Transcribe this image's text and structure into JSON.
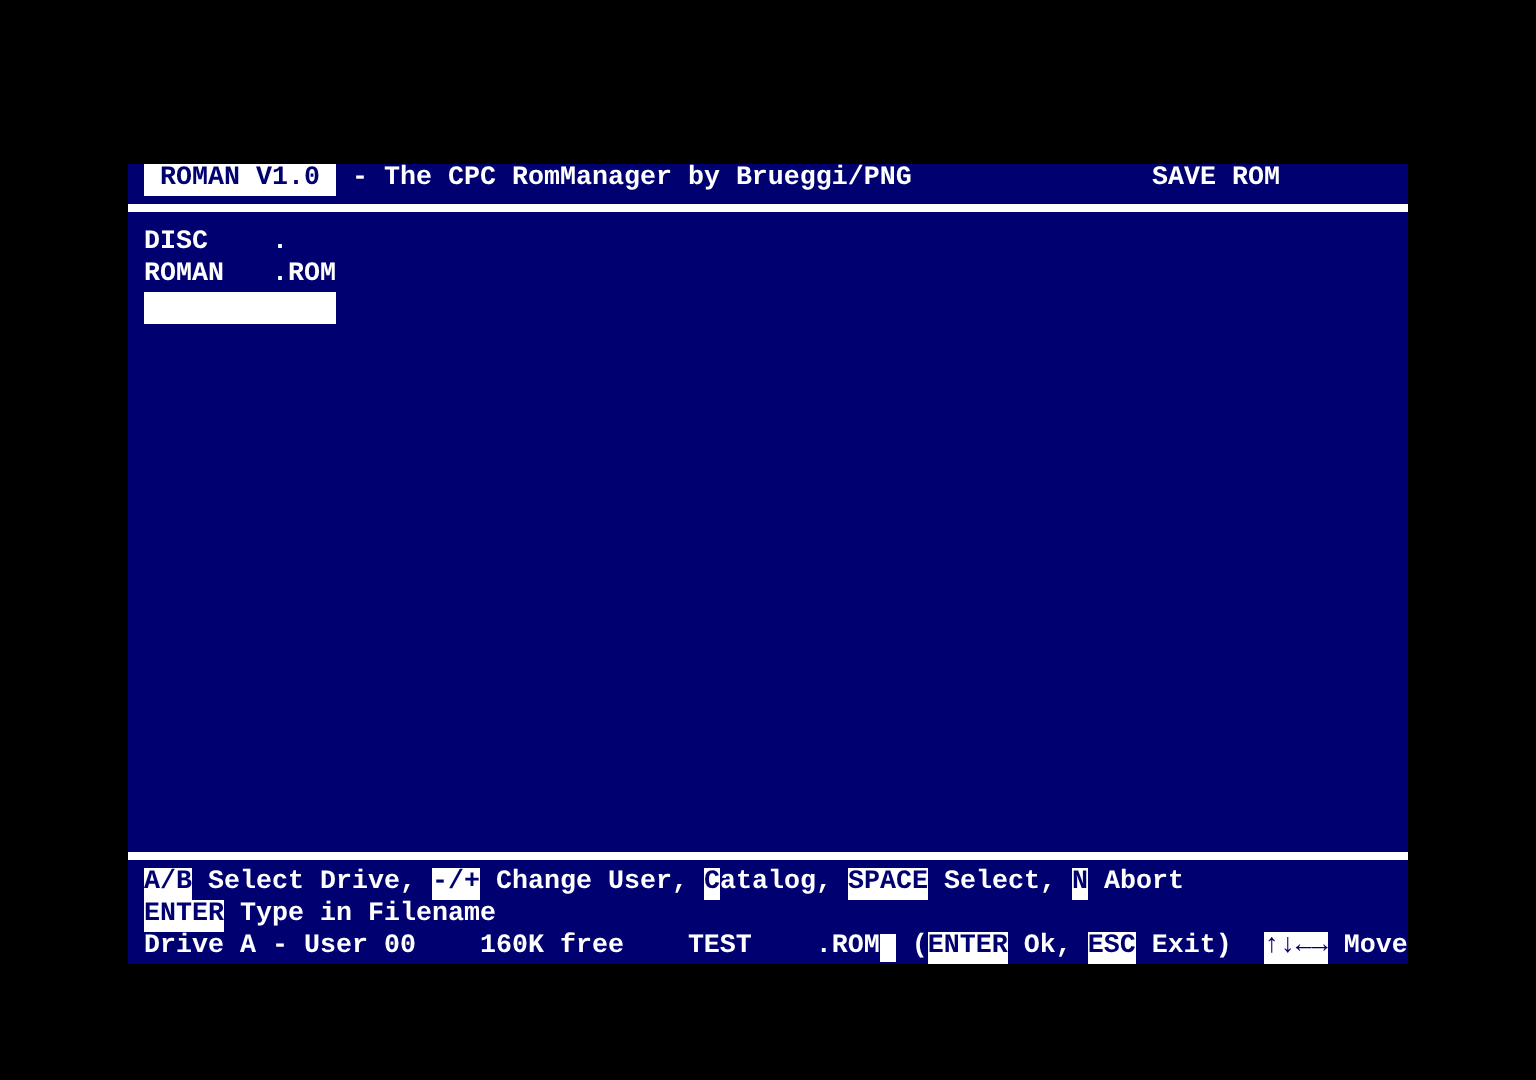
{
  "header": {
    "program": "ROMAN V1.0",
    "subtitle": " - The CPC RomManager by Brueggi/PNG",
    "mode": "SAVE ROM"
  },
  "files": [
    {
      "name": "DISC",
      "ext": "."
    },
    {
      "name": "ROMAN",
      "ext": ".ROM"
    }
  ],
  "help_lines": [
    [
      {
        "kind": "key",
        "text": "A/B"
      },
      {
        "kind": "text",
        "text": " Select Drive, "
      },
      {
        "kind": "key",
        "text": "-/+"
      },
      {
        "kind": "text",
        "text": " Change User, "
      },
      {
        "kind": "key",
        "text": "C"
      },
      {
        "kind": "text",
        "text": "atalog, "
      },
      {
        "kind": "key",
        "text": "SPACE"
      },
      {
        "kind": "text",
        "text": " Select, "
      },
      {
        "kind": "key",
        "text": "N"
      },
      {
        "kind": "text",
        "text": " Abort"
      }
    ],
    [
      {
        "kind": "key",
        "text": "ENTER"
      },
      {
        "kind": "text",
        "text": " Type in Filename"
      }
    ],
    [
      {
        "kind": "text",
        "text": "Drive A - User 00    160K free    TEST    .ROM"
      },
      {
        "kind": "cursor"
      },
      {
        "kind": "text",
        "text": " ("
      },
      {
        "kind": "key",
        "text": "ENTER"
      },
      {
        "kind": "text",
        "text": " Ok, "
      },
      {
        "kind": "key",
        "text": "ESC"
      },
      {
        "kind": "text",
        "text": " Exit)  "
      },
      {
        "kind": "key",
        "text": "↑↓←→"
      },
      {
        "kind": "text",
        "text": " Move"
      }
    ]
  ]
}
